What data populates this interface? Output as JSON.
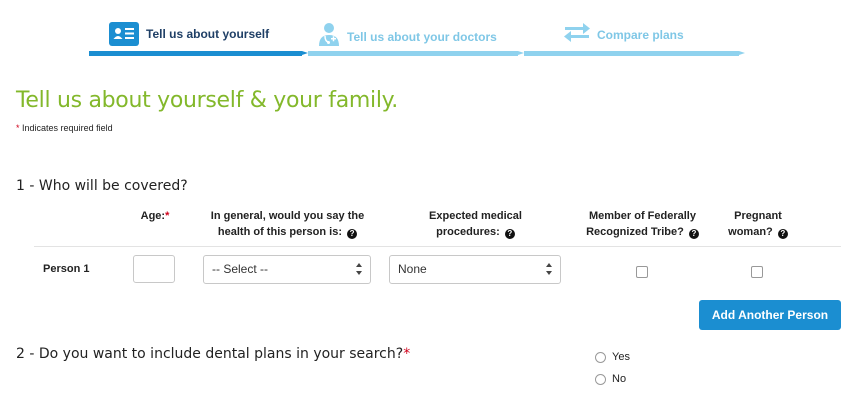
{
  "stepper": {
    "steps": [
      {
        "label": "Tell us about yourself",
        "icon": "id-card-icon",
        "state": "active"
      },
      {
        "label": "Tell us about your doctors",
        "icon": "doctor-icon",
        "state": "upcoming"
      },
      {
        "label": "Compare plans",
        "icon": "swap-arrows-icon",
        "state": "upcoming"
      }
    ],
    "colors": {
      "active": "#1b8ed1",
      "upcoming": "#8fd2ee"
    }
  },
  "page": {
    "title": "Tell us about yourself & your family.",
    "required_star": "*",
    "required_note": "Indicates required field",
    "title_color": "#83b82b"
  },
  "section1": {
    "heading": "1 - Who will be covered?",
    "columns": {
      "age": "Age:",
      "age_star": "*",
      "health_line1": "In general, would you say the",
      "health_line2": "health of this person is:",
      "procedures_line1": "Expected medical",
      "procedures_line2": "procedures:",
      "tribe_line1": "Member of Federally",
      "tribe_line2": "Recognized Tribe?",
      "pregnant_line1": "Pregnant",
      "pregnant_line2": "woman?",
      "help_glyph": "?"
    },
    "persons": [
      {
        "label": "Person 1",
        "age": "",
        "health": "-- Select --",
        "procedures": "None",
        "tribe_member": false,
        "pregnant": false
      }
    ],
    "add_button": "Add Another Person"
  },
  "section2": {
    "heading": "2 - Do you want to include dental plans in your search?",
    "star": "*",
    "options": [
      "Yes",
      "No"
    ],
    "selected": null
  }
}
